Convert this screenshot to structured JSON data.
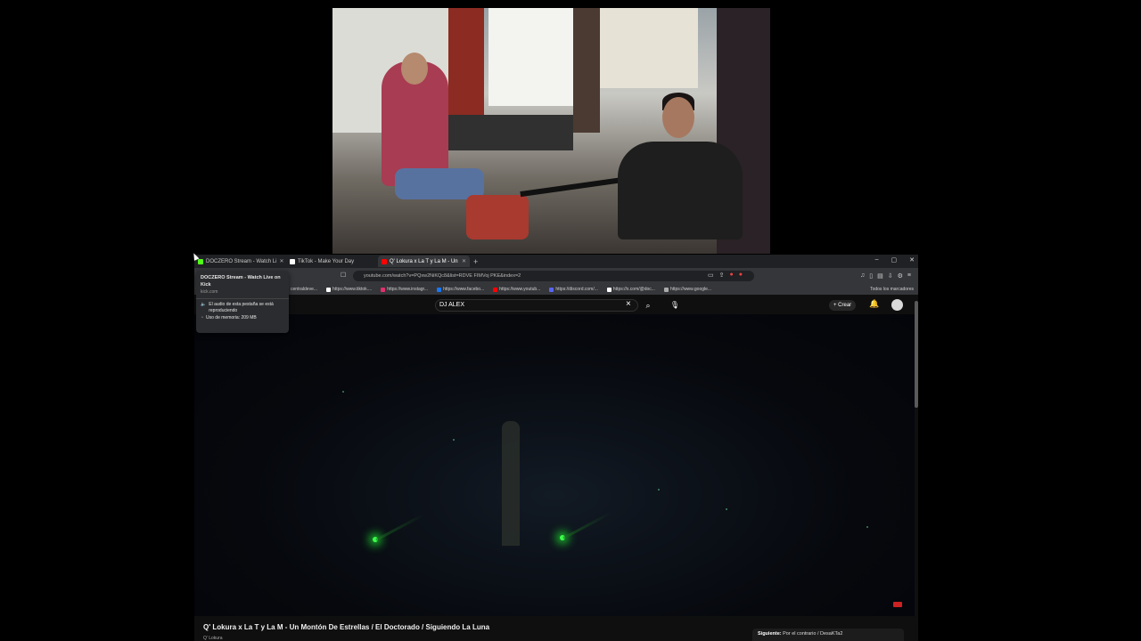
{
  "tabs": [
    {
      "label": "DOCZERO Stream - Watch Li",
      "icon": "kick-icon",
      "color": "#53fc18"
    },
    {
      "label": "TikTok - Make Your Day",
      "icon": "tiktok-icon",
      "color": "#ffffff"
    },
    {
      "label": "Q' Lokura x La T y La M - Un",
      "icon": "youtube-icon",
      "color": "#ff0000",
      "active": true
    }
  ],
  "window_controls": [
    "–",
    "▢",
    "✕"
  ],
  "address_bar": {
    "url": "youtube.com/watch?v=PQxw2NiKQc8&list=RDVE FIMVoj PKE&index=2"
  },
  "bookmarks": [
    {
      "label": "centraldeve...",
      "color": "#888888"
    },
    {
      "label": "https://www.tiktok....",
      "color": "#ffffff"
    },
    {
      "label": "https://www.instagr...",
      "color": "#e1306c"
    },
    {
      "label": "https://www.facebo...",
      "color": "#1877f2"
    },
    {
      "label": "https://www.youtub...",
      "color": "#ff0000"
    },
    {
      "label": "https://discord.com/...",
      "color": "#5865f2"
    },
    {
      "label": "https://x.com/@doc...",
      "color": "#ffffff"
    },
    {
      "label": "https://www.google...",
      "color": "#aaaaaa"
    }
  ],
  "bookmarks_right": "Todos los marcadores",
  "youtube": {
    "search_value": "DJ ALEX",
    "create_label": "Crear",
    "video_title": "Q' Lokura x La T y La M - Un Montón De Estrellas / El Doctorado / Siguiendo La Luna",
    "channel": "Q' Lokura",
    "up_next_label": "Siguiente:",
    "up_next_title": "Por el contrario / DesaKTa2"
  },
  "hover_card": {
    "title": "DOCZERO Stream - Watch Live on Kick",
    "site": "kick.com",
    "audio_status": "El audio de esta pestaña se está reproduciendo",
    "memory": "Uso de memoria: 209 MB"
  },
  "colors": {
    "accent": "#3bff4a",
    "browser_bg": "#0f0f0f",
    "chrome_bg": "#35363a"
  }
}
